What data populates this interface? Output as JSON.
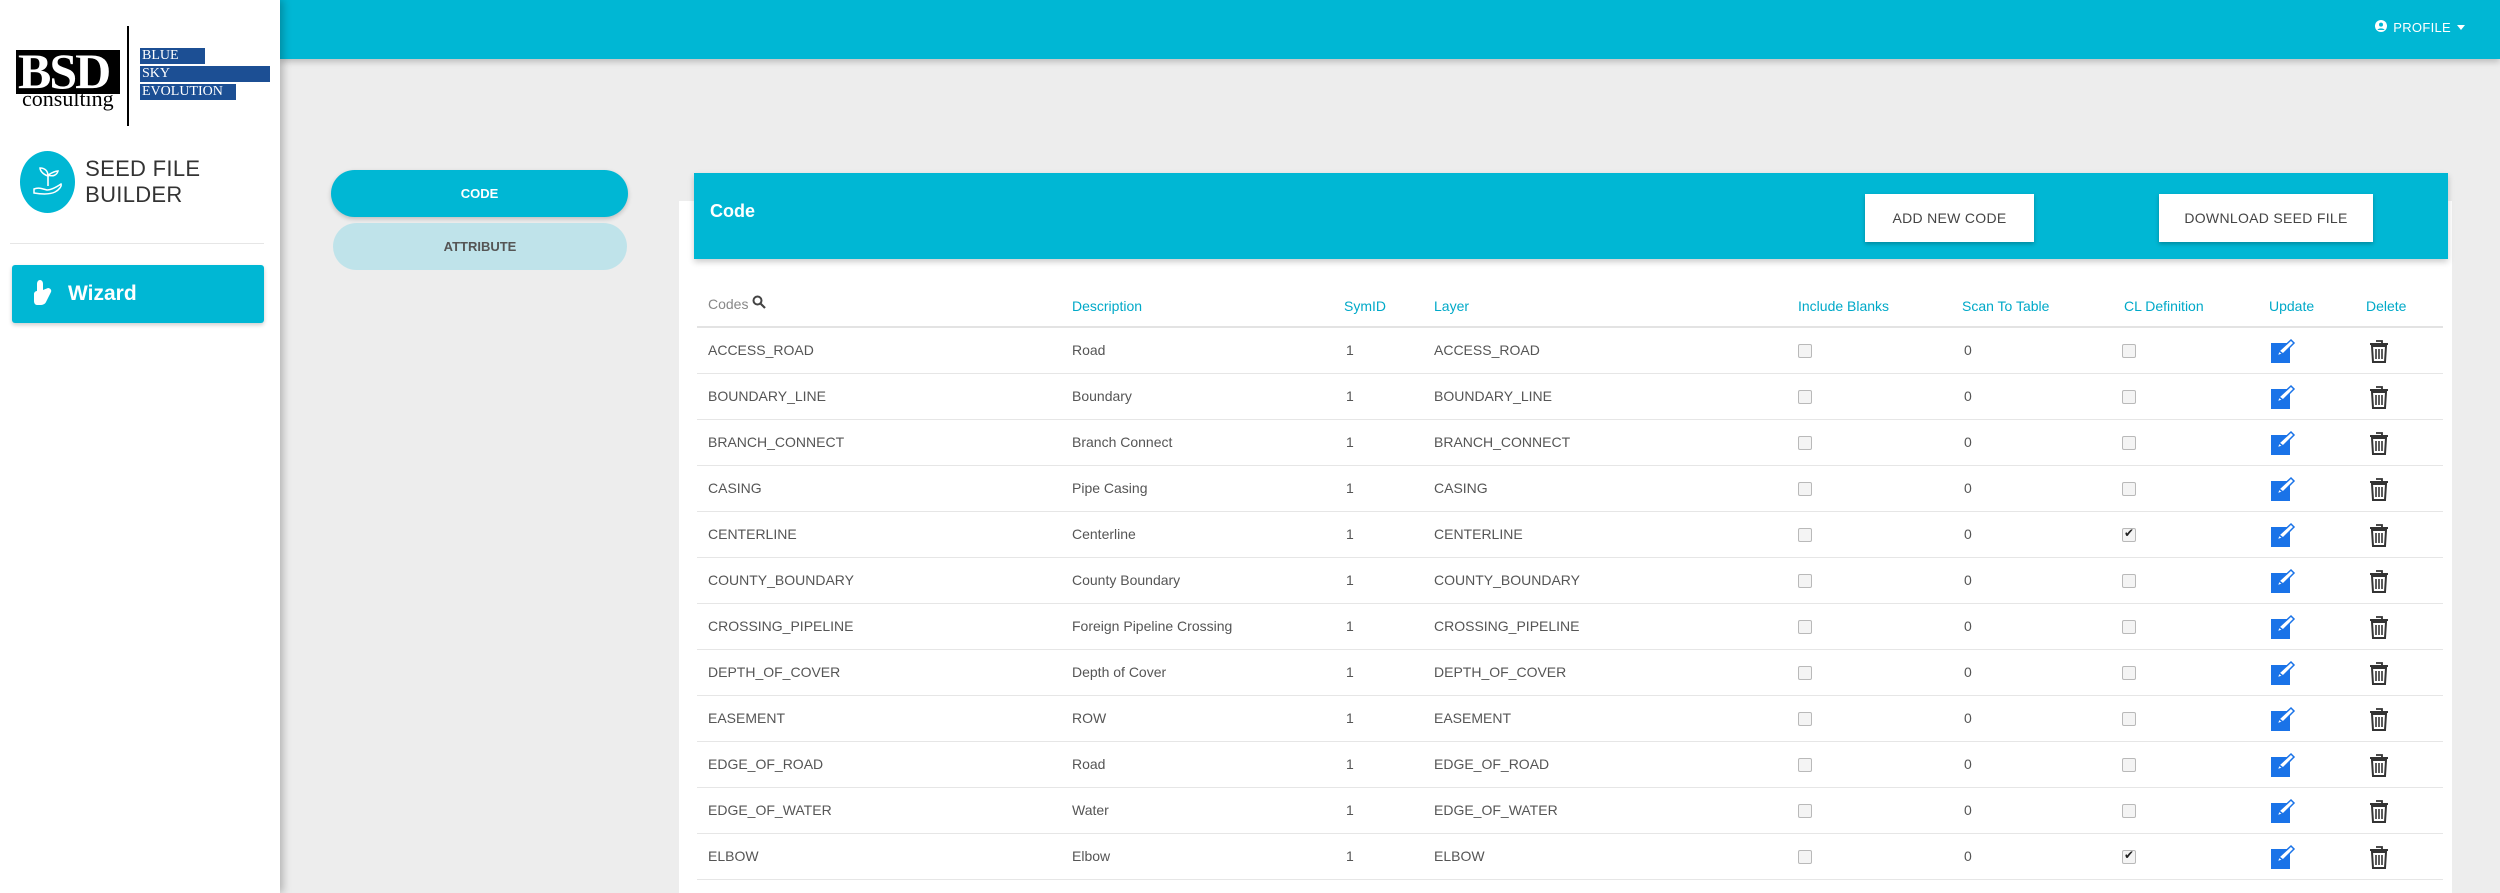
{
  "logo": {
    "mark": "BSD",
    "sub": "consulting",
    "lines": [
      "BLUE",
      "SKY",
      "EVOLUTION"
    ]
  },
  "brand": {
    "title": "SEED FILE BUILDER",
    "icon": "seedling-hand-icon"
  },
  "nav": {
    "wizard_label": "Wizard",
    "wizard_icon": "hand-icon"
  },
  "topbar": {
    "profile_label": "PROFILE",
    "profile_icon": "user-circle-icon"
  },
  "tabs": {
    "code": "CODE",
    "attribute": "ATTRIBUTE"
  },
  "card": {
    "title": "Code",
    "add_button": "ADD NEW CODE",
    "download_button": "DOWNLOAD SEED FILE"
  },
  "table": {
    "headers": {
      "code": "Codes",
      "description": "Description",
      "symid": "SymID",
      "layer": "Layer",
      "include_blanks": "Include Blanks",
      "scan_to_table": "Scan To Table",
      "cl_definition": "CL Definition",
      "update": "Update",
      "delete": "Delete"
    },
    "rows": [
      {
        "code": "ACCESS_ROAD",
        "description": "Road",
        "symid": "1",
        "layer": "ACCESS_ROAD",
        "include_blanks": false,
        "scan": "0",
        "cl": false
      },
      {
        "code": "BOUNDARY_LINE",
        "description": "Boundary",
        "symid": "1",
        "layer": "BOUNDARY_LINE",
        "include_blanks": false,
        "scan": "0",
        "cl": false
      },
      {
        "code": "BRANCH_CONNECT",
        "description": "Branch Connect",
        "symid": "1",
        "layer": "BRANCH_CONNECT",
        "include_blanks": false,
        "scan": "0",
        "cl": false
      },
      {
        "code": "CASING",
        "description": "Pipe Casing",
        "symid": "1",
        "layer": "CASING",
        "include_blanks": false,
        "scan": "0",
        "cl": false
      },
      {
        "code": "CENTERLINE",
        "description": "Centerline",
        "symid": "1",
        "layer": "CENTERLINE",
        "include_blanks": false,
        "scan": "0",
        "cl": true
      },
      {
        "code": "COUNTY_BOUNDARY",
        "description": "County Boundary",
        "symid": "1",
        "layer": "COUNTY_BOUNDARY",
        "include_blanks": false,
        "scan": "0",
        "cl": false
      },
      {
        "code": "CROSSING_PIPELINE",
        "description": "Foreign Pipeline Crossing",
        "symid": "1",
        "layer": "CROSSING_PIPELINE",
        "include_blanks": false,
        "scan": "0",
        "cl": false
      },
      {
        "code": "DEPTH_OF_COVER",
        "description": "Depth of Cover",
        "symid": "1",
        "layer": "DEPTH_OF_COVER",
        "include_blanks": false,
        "scan": "0",
        "cl": false
      },
      {
        "code": "EASEMENT",
        "description": "ROW",
        "symid": "1",
        "layer": "EASEMENT",
        "include_blanks": false,
        "scan": "0",
        "cl": false
      },
      {
        "code": "EDGE_OF_ROAD",
        "description": "Road",
        "symid": "1",
        "layer": "EDGE_OF_ROAD",
        "include_blanks": false,
        "scan": "0",
        "cl": false
      },
      {
        "code": "EDGE_OF_WATER",
        "description": "Water",
        "symid": "1",
        "layer": "EDGE_OF_WATER",
        "include_blanks": false,
        "scan": "0",
        "cl": false
      },
      {
        "code": "ELBOW",
        "description": "Elbow",
        "symid": "1",
        "layer": "ELBOW",
        "include_blanks": false,
        "scan": "0",
        "cl": true
      }
    ]
  },
  "colors": {
    "accent": "#00b7d4",
    "edit_icon": "#1a73e8",
    "header_text": "#00a9c8"
  }
}
